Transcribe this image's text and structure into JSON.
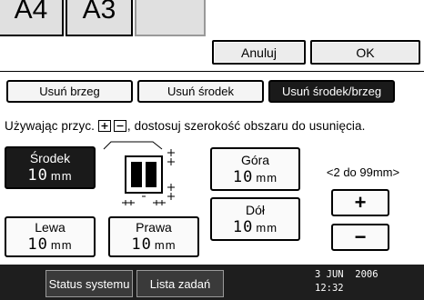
{
  "top": {
    "partial_buttons": [
      "A4",
      "A3"
    ],
    "cancel_label": "Anuluj",
    "ok_label": "OK"
  },
  "tabs": [
    {
      "label": "Usuń brzeg",
      "selected": false
    },
    {
      "label": "Usuń środek",
      "selected": false
    },
    {
      "label": "Usuń środek/brzeg",
      "selected": true
    }
  ],
  "instruction": {
    "before": "Używając przyc.",
    "after": ", dostosuj szerokość obszaru do usunięcia."
  },
  "margins": {
    "center": {
      "label": "Środek",
      "value": "10",
      "unit": "mm"
    },
    "top": {
      "label": "Góra",
      "value": "10",
      "unit": "mm"
    },
    "bottom": {
      "label": "Dół",
      "value": "10",
      "unit": "mm"
    },
    "left": {
      "label": "Lewa",
      "value": "10",
      "unit": "mm"
    },
    "right": {
      "label": "Prawa",
      "value": "10",
      "unit": "mm"
    }
  },
  "range_text": "<2 do 99mm>",
  "plus_label": "+",
  "minus_label": "−",
  "statusbar": {
    "status_label": "Status systemu",
    "jobs_label": "Lista zadań",
    "date": "3 JUN  2006",
    "time": "12:32"
  },
  "colors": {
    "selected_bg": "#1a1a1a",
    "statusbar_bg": "#1e1e1e",
    "button_bg": "#fafafa"
  }
}
